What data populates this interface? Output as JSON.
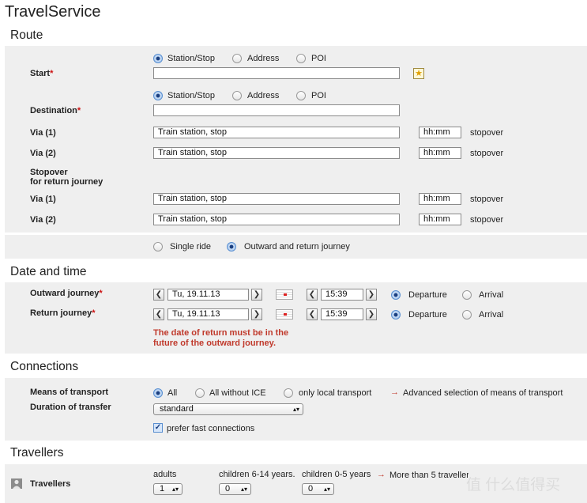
{
  "app_title": "TravelService",
  "route": {
    "title": "Route",
    "start_label": "Start",
    "destination_label": "Destination",
    "required_mark": "*",
    "type_options": [
      "Station/Stop",
      "Address",
      "POI"
    ],
    "start_value": "",
    "destination_value": "",
    "via1_label": "Via (1)",
    "via2_label": "Via (2)",
    "via_placeholder": "Train station, stop",
    "time_placeholder": "hh:mm",
    "stopover_label": "stopover",
    "return_stopover_label_line1": "Stopover",
    "return_stopover_label_line2": "for return journey",
    "single_ride_label": "Single ride",
    "outward_return_label": "Outward and return journey"
  },
  "datetime": {
    "title": "Date and time",
    "outward_label": "Outward journey",
    "return_label": "Return journey",
    "outward_date": "Tu, 19.11.13",
    "outward_time": "15:39",
    "return_date": "Tu, 19.11.13",
    "return_time": "15:39",
    "departure_label": "Departure",
    "arrival_label": "Arrival",
    "prev_glyph": "❮",
    "next_glyph": "❯",
    "error_line1": "The date of return must be in the",
    "error_line2": "future of the outward journey."
  },
  "connections": {
    "title": "Connections",
    "means_label": "Means of transport",
    "means_options": [
      "All",
      "All without ICE",
      "only local transport"
    ],
    "advanced_link": "Advanced selection of means of transport",
    "transfer_label": "Duration of transfer",
    "transfer_value": "standard",
    "prefer_fast_label": "prefer fast connections",
    "link_arrow": "→"
  },
  "travellers": {
    "title": "Travellers",
    "row_label": "Travellers",
    "adults_label": "adults",
    "adults_value": "1",
    "children_6_14_label": "children 6-14 years.",
    "children_6_14_value": "0",
    "children_0_5_label": "children 0-5 years",
    "children_0_5_value": "0",
    "more_link": "More than 5 travellers",
    "watermark": "值 什么值得买"
  },
  "icons": {
    "star": "★",
    "check": "✓",
    "select_arrows": "▴▾"
  }
}
